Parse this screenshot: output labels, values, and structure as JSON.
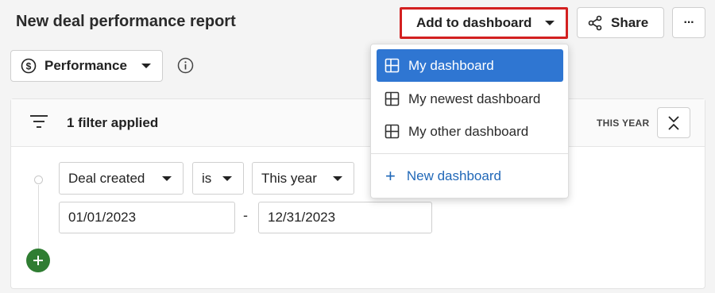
{
  "report": {
    "title": "New deal performance report"
  },
  "toolbar": {
    "add_to_dashboard_label": "Add to dashboard",
    "share_label": "Share",
    "more_label": "···"
  },
  "view": {
    "performance_label": "Performance"
  },
  "filters": {
    "summary": "1 filter applied",
    "period_badge": "THIS YEAR",
    "rows": [
      {
        "field": "Deal created",
        "operator": "is",
        "period": "This year",
        "start_date": "01/01/2023",
        "separator": "-",
        "end_date": "12/31/2023"
      }
    ]
  },
  "dashboard_menu": {
    "items": [
      {
        "label": "My dashboard",
        "selected": true,
        "icon": "dashboard-grid-icon"
      },
      {
        "label": "My newest dashboard",
        "selected": false,
        "icon": "dashboard-grid-icon"
      },
      {
        "label": "My other dashboard",
        "selected": false,
        "icon": "dashboard-grid-icon"
      }
    ],
    "new_label": "New dashboard"
  },
  "colors": {
    "highlight_border": "#d32020",
    "selected_item": "#2f76d2",
    "link": "#2168b8",
    "add_filter_button": "#2f7d32"
  }
}
